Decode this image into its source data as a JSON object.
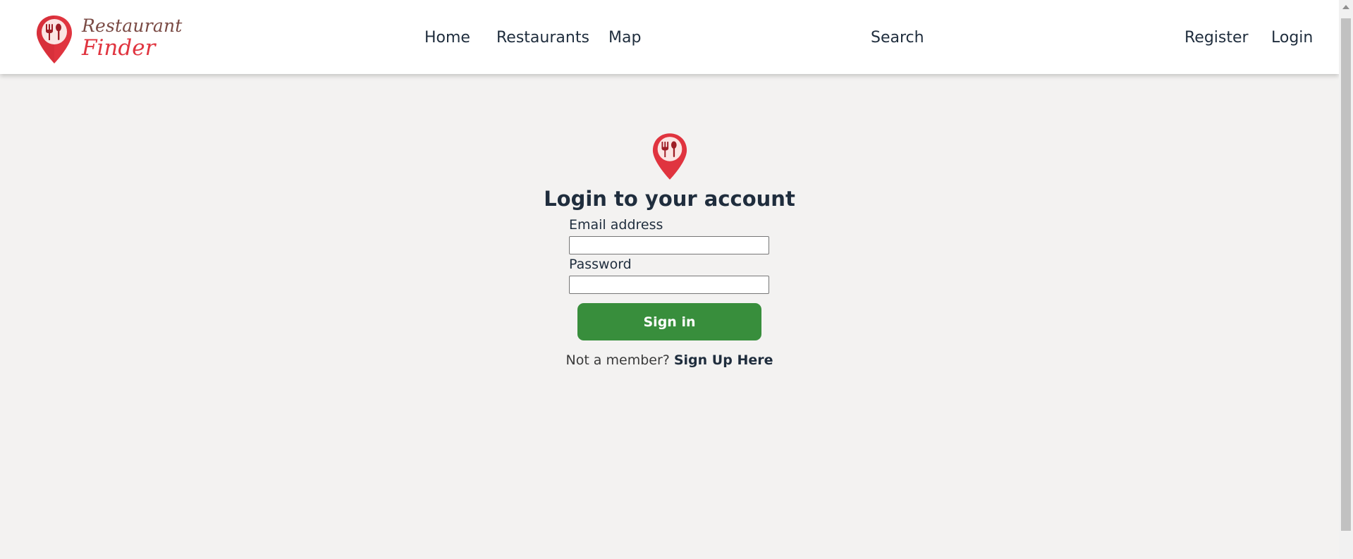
{
  "brand": {
    "line1": "Restaurant",
    "line2": "Finder",
    "logo_icon": "map-pin-fork-spoon-icon",
    "accent_color": "#e0343f"
  },
  "nav": {
    "home": "Home",
    "restaurants": "Restaurants",
    "map": "Map",
    "search": "Search",
    "register": "Register",
    "login": "Login"
  },
  "login_form": {
    "icon": "map-pin-fork-spoon-icon",
    "title": "Login to your account",
    "email_label": "Email address",
    "email_value": "",
    "password_label": "Password",
    "password_value": "",
    "submit_label": "Sign in",
    "submit_color": "#388e3c",
    "signup_prompt": "Not a member?",
    "signup_link": "Sign Up Here"
  }
}
